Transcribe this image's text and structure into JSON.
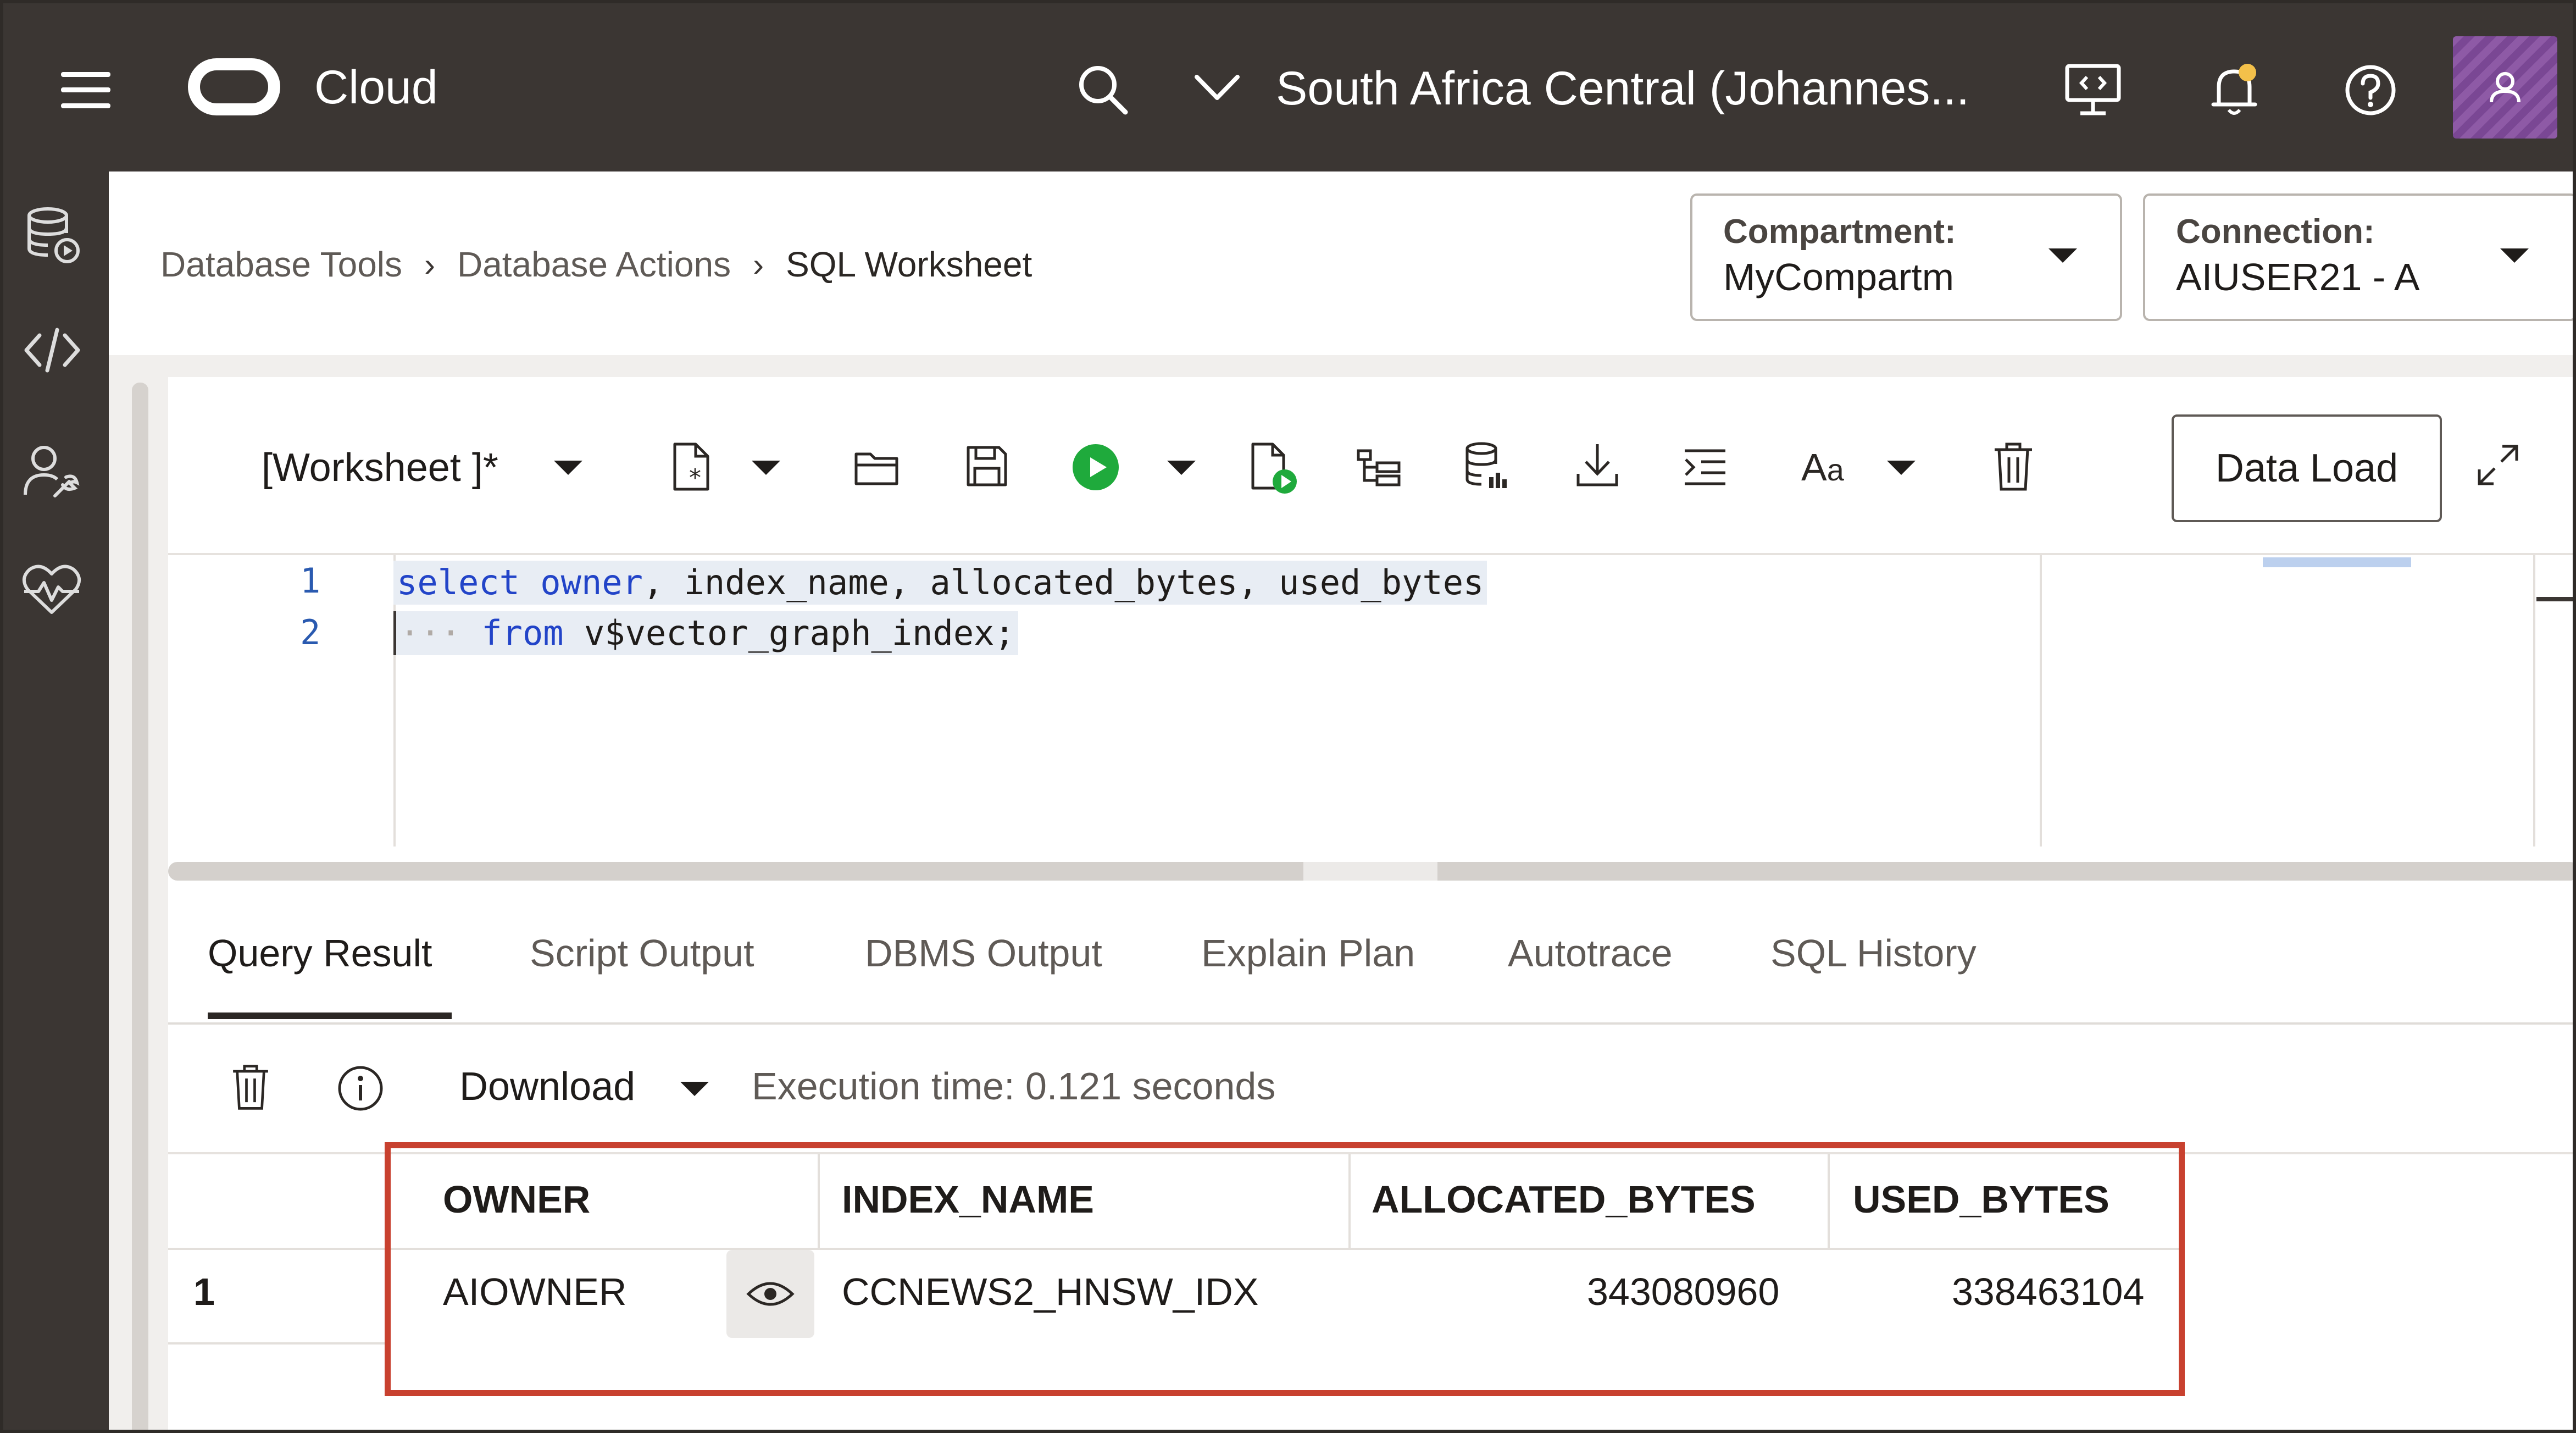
{
  "topbar": {
    "brand": "Cloud",
    "region": "South Africa Central (Johannes..."
  },
  "breadcrumb": {
    "items": [
      "Database Tools",
      "Database Actions"
    ],
    "current": "SQL Worksheet"
  },
  "compartment": {
    "label": "Compartment:",
    "value": "MyCompartm"
  },
  "connection": {
    "label": "Connection:",
    "value": "AIUSER21 - A"
  },
  "toolbar": {
    "worksheet_name": "[Worksheet ]*",
    "data_load_label": "Data Load"
  },
  "editor": {
    "line_numbers": [
      "1",
      "2"
    ],
    "line1": {
      "kw1": "select",
      "kw2": "owner",
      "rest": ", index_name, allocated_bytes, used_bytes"
    },
    "line2": {
      "indent": "···",
      "kw": "from",
      "rest": " v$vector_graph_index;"
    }
  },
  "tabs": [
    "Query Result",
    "Script Output",
    "DBMS Output",
    "Explain Plan",
    "Autotrace",
    "SQL History"
  ],
  "result_toolbar": {
    "download_label": "Download",
    "execution_time": "Execution time: 0.121 seconds"
  },
  "grid": {
    "columns": [
      "OWNER",
      "INDEX_NAME",
      "ALLOCATED_BYTES",
      "USED_BYTES"
    ],
    "rows": [
      {
        "num": "1",
        "owner": "AIOWNER",
        "index_name": "CCNEWS2_HNSW_IDX",
        "allocated_bytes": "343080960",
        "used_bytes": "338463104"
      }
    ]
  },
  "colors": {
    "topbar": "#3b3633",
    "run_green": "#1faa3c",
    "highlight_red": "#c8412f",
    "sql_keyword": "#2244c8"
  }
}
